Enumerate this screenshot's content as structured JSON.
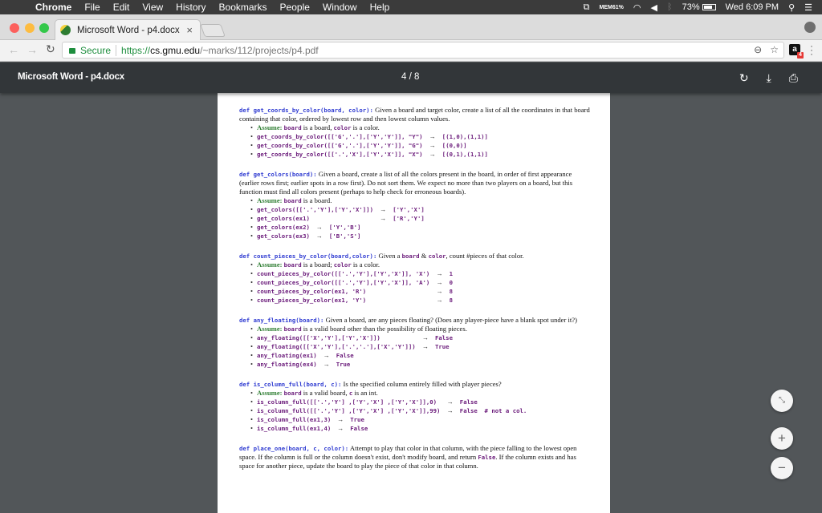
{
  "menubar": {
    "apple": "",
    "items": [
      "Chrome",
      "File",
      "Edit",
      "View",
      "History",
      "Bookmarks",
      "People",
      "Window",
      "Help"
    ],
    "status": {
      "mem_label": "MEM",
      "mem_value": "61%",
      "battery": "73%",
      "clock": "Wed 6:09 PM"
    }
  },
  "browser": {
    "tab_title": "Microsoft Word - p4.docx",
    "tab_close": "×",
    "secure_label": "Secure",
    "url_scheme": "https://",
    "url_host": "cs.gmu.edu",
    "url_path": "/~marks/112/projects/p4.pdf",
    "extension_badge": "4",
    "extension_letter": "a"
  },
  "pdf": {
    "title": "Microsoft Word - p4.docx",
    "current_page": "4",
    "total_pages": "8",
    "page_indicator": "4 / 8"
  },
  "doc": {
    "sections": [
      {
        "signature": "def get_coords_by_color(board, color):",
        "description": " Given a board and target color, create a list of all the coordinates in that board containing that color, ordered by lowest row and then lowest column values.",
        "assume_label": "Assume:",
        "assume_text": [
          {
            "code": "board"
          },
          {
            "text": " is a board, "
          },
          {
            "code": "color"
          },
          {
            "text": " is a color."
          }
        ],
        "examples": [
          {
            "call": "get_coords_by_color([['G','.'],['Y','Y']], \"Y\")",
            "result": "[(1,0),(1,1)]"
          },
          {
            "call": "get_coords_by_color([['G','.'],['Y','Y']], \"G\")",
            "result": "[(0,0)]"
          },
          {
            "call": "get_coords_by_color([['.','X'],['Y','X']], \"X\")",
            "result": "[(0,1),(1,1)]"
          }
        ]
      },
      {
        "signature": "def get_colors(board):",
        "description": " Given a board, create a list of all the colors present in the board, in order of first appearance (earlier rows first; earlier spots in a row first). Do not sort them. We expect no more than two players on a board, but this function must find all colors present (perhaps to help check for erroneous boards).",
        "assume_label": "Assume:",
        "assume_text": [
          {
            "code": "board"
          },
          {
            "text": " is a board."
          }
        ],
        "examples": [
          {
            "call": "get_colors([['.','Y'],['Y','X']])",
            "result": "['Y','X']"
          },
          {
            "call": "get_colors(ex1)",
            "result": "['R','Y']"
          },
          {
            "call": "get_colors(ex2)",
            "result": "['Y','B']"
          },
          {
            "call": "get_colors(ex3)",
            "result": "['B','S']"
          }
        ]
      },
      {
        "signature": "def count_pieces_by_color(board,color):",
        "description_parts": [
          {
            "text": " Given a "
          },
          {
            "code": "board"
          },
          {
            "text": " & "
          },
          {
            "code": "color"
          },
          {
            "text": ", count #pieces of that color."
          }
        ],
        "assume_label": "Assume:",
        "assume_text": [
          {
            "code": "board"
          },
          {
            "text": " is a board; "
          },
          {
            "code": "color"
          },
          {
            "text": " is a color."
          }
        ],
        "examples": [
          {
            "call": "count_pieces_by_color([['.','Y'],['Y','X']], 'X')",
            "result": "1"
          },
          {
            "call": "count_pieces_by_color([['.','Y'],['Y','X']], 'A')",
            "result": "0"
          },
          {
            "call": "count_pieces_by_color(ex1, 'R')",
            "result": "8"
          },
          {
            "call": "count_pieces_by_color(ex1, 'Y')",
            "result": "8"
          }
        ]
      },
      {
        "signature": "def any_floating(board):",
        "description": " Given a board, are any pieces floating? (Does any player-piece have a blank spot under it?)",
        "assume_label": "Assume:",
        "assume_text": [
          {
            "code": "board"
          },
          {
            "text": " is a valid board other than the possibility of floating pieces."
          }
        ],
        "examples": [
          {
            "call": "any_floating([['X','Y'],['Y','X']])",
            "result": "False"
          },
          {
            "call": "any_floating([['X','Y'],['.','.'],['X','Y']])",
            "result": "True"
          },
          {
            "call": "any_floating(ex1)",
            "result": "False"
          },
          {
            "call": "any_floating(ex4)",
            "result": "True"
          }
        ]
      },
      {
        "signature": "def is_column_full(board, c):",
        "description": " Is the specified column entirely filled with player pieces?",
        "assume_label": "Assume:",
        "assume_text": [
          {
            "code": "board"
          },
          {
            "text": " is a valid board, "
          },
          {
            "code": "c"
          },
          {
            "text": " is an int."
          }
        ],
        "examples": [
          {
            "call": "is_column_full([['.','Y'] ,['Y','X'] ,['Y','X']],0)",
            "result": "False"
          },
          {
            "call": "is_column_full([['.','Y'] ,['Y','X'] ,['Y','X']],99)",
            "result": "False  # not a col."
          },
          {
            "call": "is_column_full(ex1,3)",
            "result": "True"
          },
          {
            "call": "is_column_full(ex1,4)",
            "result": "False"
          }
        ]
      },
      {
        "signature": "def place_one(board, c, color):",
        "description_parts": [
          {
            "text": " Attempt to play that color in that column, with the piece falling to the lowest open space. If the column is full or the column doesn't exist, don't modify board, and return "
          },
          {
            "code": "False"
          },
          {
            "text": ". If the column exists and has space for another piece, update the board to play the piece of that color in that column."
          }
        ]
      }
    ]
  },
  "zoom_controls": {
    "fit": "fit-to-page",
    "zoom_in": "+",
    "zoom_out": "−"
  }
}
